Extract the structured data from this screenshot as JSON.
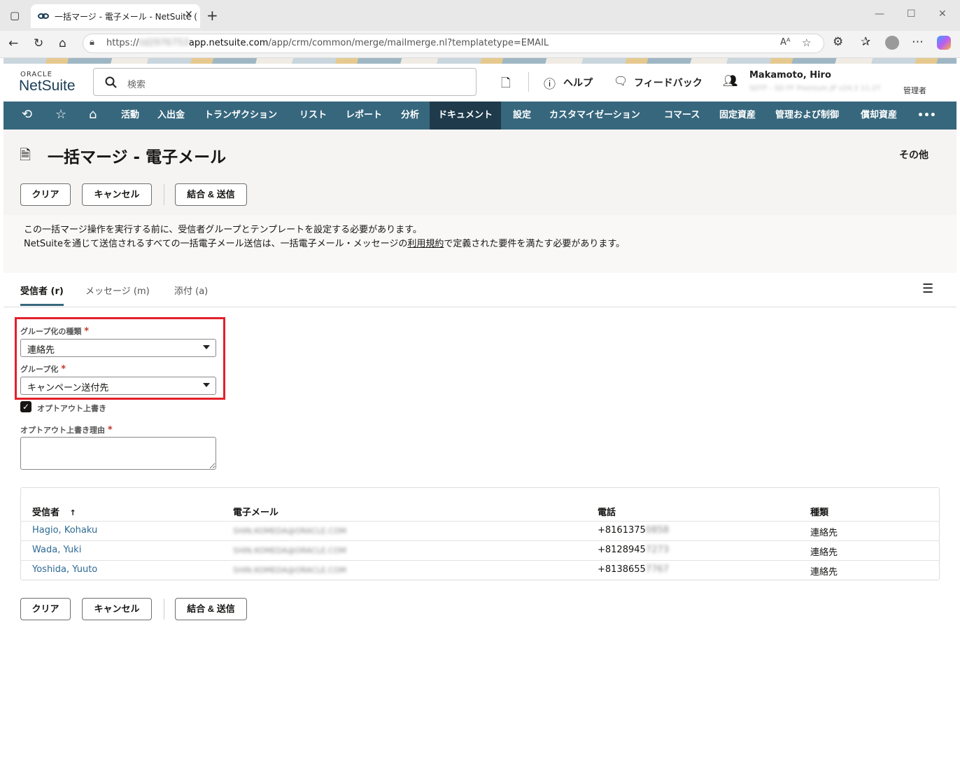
{
  "browser": {
    "tab_title": "一括マージ - 電子メール - NetSuite (",
    "url_prefix": "https://",
    "url_redacted": "td2976753",
    "url_domain": "app.netsuite.com",
    "url_path": "/app/crm/common/merge/mailmerge.nl?templatetype=EMAIL"
  },
  "header": {
    "logo_top": "ORACLE",
    "logo_main": "NetSuite",
    "search_placeholder": "検索",
    "help_label": "ヘルプ",
    "feedback_label": "フィードバック",
    "user_name": "Makamoto, Hiro",
    "user_account": "SDTF - SD FF Premium JP v24.2 11.27",
    "user_role": "管理者"
  },
  "nav": {
    "items": [
      "活動",
      "入出金",
      "トランザクション",
      "リスト",
      "レポート",
      "分析",
      "ドキュメント",
      "設定",
      "カスタマイゼーション",
      "コマース",
      "固定資産",
      "管理および制御",
      "償却資産"
    ],
    "active": "ドキュメント",
    "more": "•••"
  },
  "page": {
    "title": "一括マージ - 電子メール",
    "more_label": "その他",
    "buttons": {
      "clear": "クリア",
      "cancel": "キャンセル",
      "merge_send": "結合 & 送信"
    },
    "info_line1": "この一括マージ操作を実行する前に、受信者グループとテンプレートを設定する必要があります。",
    "info_line2_pre": "NetSuiteを通じて送信されるすべての一括電子メール送信は、一括電子メール・メッセージの",
    "info_line2_link": "利用規約",
    "info_line2_post": "で定義された要件を満たす必要があります。"
  },
  "tabs": [
    {
      "label": "受信者 (r)"
    },
    {
      "label": "メッセージ (m)"
    },
    {
      "label": "添付 (a)"
    }
  ],
  "form": {
    "group_type_label": "グループ化の種類",
    "group_type_value": "連絡先",
    "group_label": "グループ化",
    "group_value": "キャンペーン送付先",
    "optout_label": "オプトアウト上書き",
    "optout_checked": true,
    "optout_reason_label": "オプトアウト上書き理由",
    "optout_reason_value": ""
  },
  "table": {
    "headers": [
      "受信者",
      "電子メール",
      "電話",
      "種類"
    ],
    "sort_indicator": "↑",
    "rows": [
      {
        "name": "Hagio, Kohaku",
        "email": "SHIN.KOMEDA@ORACLE.COM",
        "phone": "+8161375",
        "phone_tail": "0858",
        "type": "連絡先"
      },
      {
        "name": "Wada, Yuki",
        "email": "SHIN.KOMEDA@ORACLE.COM",
        "phone": "+8128945",
        "phone_tail": "7273",
        "type": "連絡先"
      },
      {
        "name": "Yoshida, Yuuto",
        "email": "SHIN.KOMEDA@ORACLE.COM",
        "phone": "+8138655",
        "phone_tail": "7767",
        "type": "連絡先"
      }
    ]
  },
  "colors": {
    "nav_bg": "#36677d",
    "nav_active": "#1e3a4b",
    "highlight": "#e3202a",
    "link": "#2d6a93"
  }
}
